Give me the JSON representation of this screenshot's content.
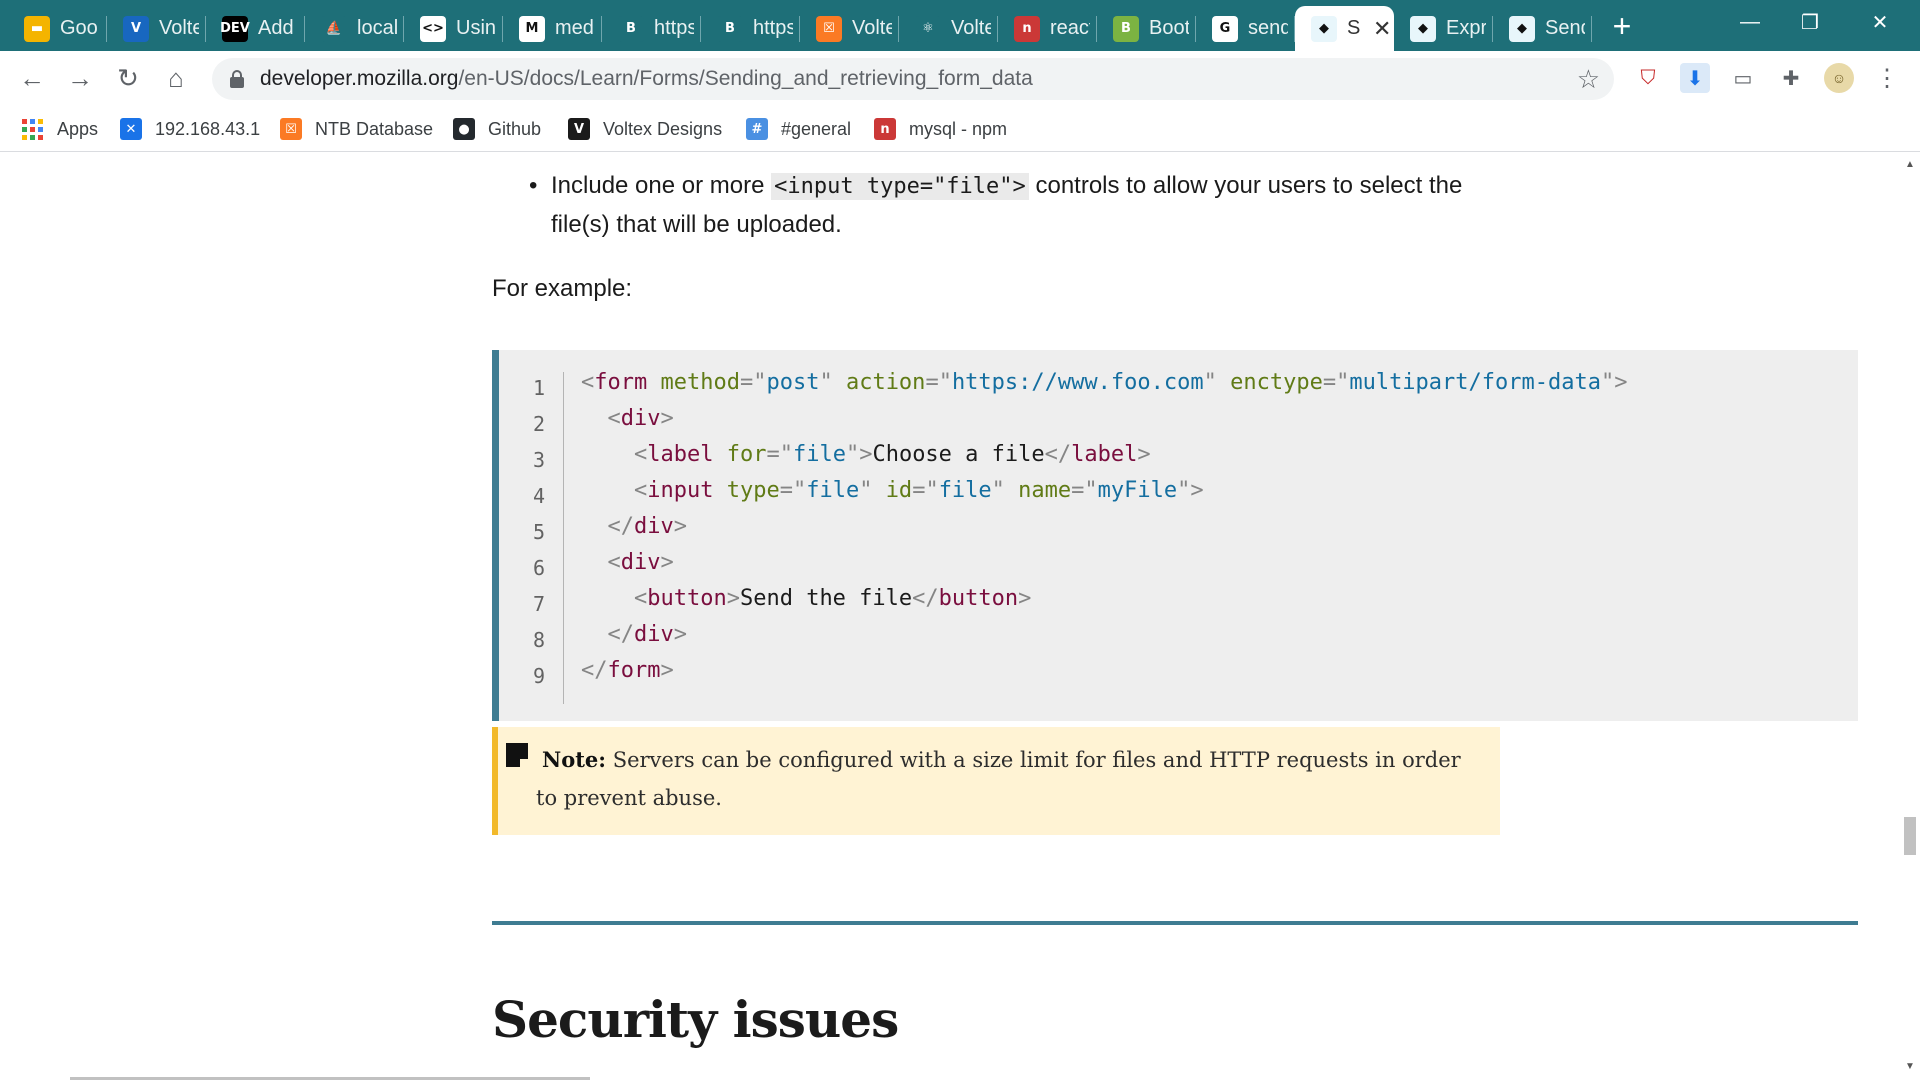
{
  "browser": {
    "tabs": [
      {
        "title": "Goo",
        "icon": "google-slides-icon",
        "color": "#f4b400",
        "glyph": "▬"
      },
      {
        "title": "Volte",
        "icon": "vuetify-icon",
        "color": "#1867c0",
        "glyph": "V"
      },
      {
        "title": "Add",
        "icon": "dev-to-icon",
        "color": "#000000",
        "glyph": "DEV"
      },
      {
        "title": "locall",
        "icon": "phpmyadmin-icon",
        "color": "#1e6f78",
        "glyph": "⛵"
      },
      {
        "title": "Usin",
        "icon": "code-icon",
        "color": "#ffffff",
        "glyph": "<>"
      },
      {
        "title": "medi",
        "icon": "medium-icon",
        "color": "#ffffff",
        "glyph": "M"
      },
      {
        "title": "https",
        "icon": "bootstrap-vue-icon",
        "color": "#1e6f78",
        "glyph": "B"
      },
      {
        "title": "https",
        "icon": "bootstrap-vue-icon",
        "color": "#1e6f78",
        "glyph": "B"
      },
      {
        "title": "Volte",
        "icon": "xampp-icon",
        "color": "#fb7a24",
        "glyph": "☒"
      },
      {
        "title": "Volte",
        "icon": "react-icon",
        "color": "#1e6f78",
        "glyph": "⚛"
      },
      {
        "title": "react",
        "icon": "npm-icon",
        "color": "#cb3837",
        "glyph": "n"
      },
      {
        "title": "Boot",
        "icon": "bootstrap-icon",
        "color": "#7cb342",
        "glyph": "B"
      },
      {
        "title": "send",
        "icon": "google-icon",
        "color": "#ffffff",
        "glyph": "G"
      },
      {
        "title": "S",
        "icon": "mdn-icon",
        "color": "#e8f6fb",
        "glyph": "◆"
      },
      {
        "title": "Expr",
        "icon": "mdn-icon",
        "color": "#e8f6fb",
        "glyph": "◆"
      },
      {
        "title": "Send",
        "icon": "mdn-icon",
        "color": "#e8f6fb",
        "glyph": "◆"
      }
    ],
    "new_tab": "+",
    "window": {
      "minimize": "—",
      "restore": "❐",
      "close": "✕"
    },
    "url": {
      "host": "developer.mozilla.org",
      "path": "/en-US/docs/Learn/Forms/Sending_and_retrieving_form_data"
    },
    "bookmarks": [
      {
        "label": "Apps",
        "icon": "apps-grid-icon"
      },
      {
        "label": "192.168.43.1",
        "icon": "router-icon",
        "color": "#1a73e8",
        "glyph": "✕"
      },
      {
        "label": "NTB Database",
        "icon": "xampp-icon",
        "color": "#fb7a24",
        "glyph": "☒"
      },
      {
        "label": "Github",
        "icon": "github-icon",
        "color": "#24292e",
        "glyph": "●"
      },
      {
        "label": "Voltex Designs",
        "icon": "vuetify-icon",
        "color": "#1b1b1b",
        "glyph": "V"
      },
      {
        "label": "#general",
        "icon": "slack-icon",
        "color": "#4a90e2",
        "glyph": "#"
      },
      {
        "label": "mysql - npm",
        "icon": "npm-icon",
        "color": "#cb3837",
        "glyph": "n"
      }
    ]
  },
  "article": {
    "bullet_before": "Include one or more ",
    "bullet_code": "<input type=\"file\">",
    "bullet_after": " controls to allow your users to select the file(s) that will be uploaded.",
    "example_intro": "For example:",
    "code_lines": [
      "1",
      "2",
      "3",
      "4",
      "5",
      "6",
      "7",
      "8",
      "9"
    ],
    "note_label": "Note:",
    "note_text": " Servers can be configured with a size limit for files and HTTP requests in order to prevent abuse.",
    "heading": "Security issues"
  }
}
